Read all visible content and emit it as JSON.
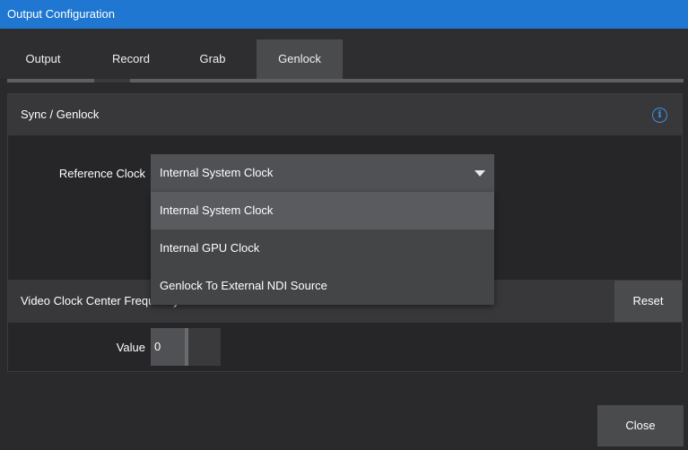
{
  "window": {
    "title": "Output Configuration"
  },
  "tabs": [
    {
      "label": "Output",
      "active": false
    },
    {
      "label": "Record",
      "active": false
    },
    {
      "label": "Grab",
      "active": false
    },
    {
      "label": "Genlock",
      "active": true
    }
  ],
  "sync_section": {
    "title": "Sync / Genlock",
    "info_icon": "info-icon",
    "reference_clock_label": "Reference Clock",
    "reference_clock_value": "Internal System Clock",
    "options": [
      "Internal System Clock",
      "Internal GPU Clock",
      "Genlock To External NDI Source"
    ],
    "highlighted_option": "Internal System Clock"
  },
  "frequency_section": {
    "title": "Video Clock Center Frequency",
    "reset_label": "Reset",
    "value_label": "Value",
    "value": "0"
  },
  "footer": {
    "close_label": "Close"
  },
  "colors": {
    "titlebar": "#1f77d1",
    "accent_info": "#3a8fe8",
    "active_tab": "#4a4b4d"
  }
}
